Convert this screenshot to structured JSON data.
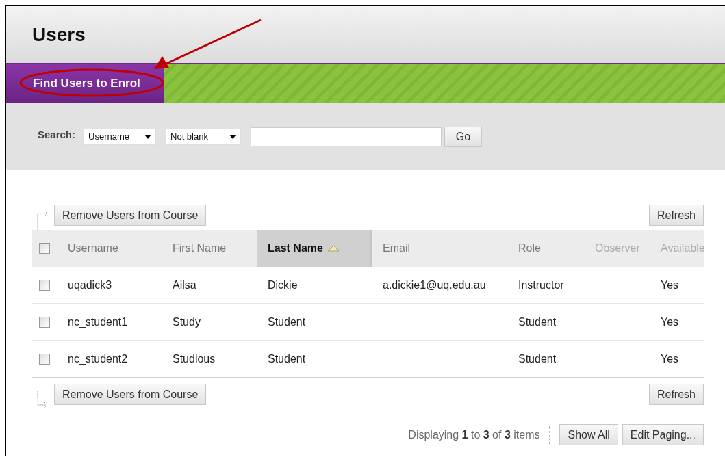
{
  "page": {
    "title": "Users"
  },
  "action_bar": {
    "buttons": [
      {
        "label": "Find Users to Enrol",
        "highlighted": true
      }
    ]
  },
  "search": {
    "label": "Search:",
    "field_select": "Username",
    "operator_select": "Not blank",
    "button": "Go"
  },
  "top_actions": {
    "remove_button": "Remove Users from Course",
    "refresh_button": "Refresh"
  },
  "table": {
    "select_all": {
      "checked": false
    },
    "columns": [
      {
        "label": "Username",
        "sorted": false,
        "disabled": false
      },
      {
        "label": "First Name",
        "sorted": false,
        "disabled": false
      },
      {
        "label": "Last Name",
        "sorted": true,
        "disabled": false
      },
      {
        "label": "Email",
        "sorted": false,
        "disabled": false
      },
      {
        "label": "Role",
        "sorted": false,
        "disabled": false
      },
      {
        "label": "Observer",
        "sorted": false,
        "disabled": true
      },
      {
        "label": "Available",
        "sorted": false,
        "disabled": true
      }
    ],
    "rows": [
      {
        "checked": false,
        "cells": [
          "uqadick3",
          "Ailsa",
          "Dickie",
          "a.dickie1@uq.edu.au",
          "Instructor",
          "",
          "Yes"
        ]
      },
      {
        "checked": false,
        "cells": [
          "nc_student1",
          "Study",
          "Student",
          "",
          "Student",
          "",
          "Yes"
        ]
      },
      {
        "checked": false,
        "cells": [
          "nc_student2",
          "Studious",
          "Student",
          "",
          "Student",
          "",
          "Yes"
        ]
      }
    ]
  },
  "bottom_actions": {
    "remove_button": "Remove Users from Course",
    "refresh_button": "Refresh"
  },
  "paging": {
    "summary": "Displaying **1** to **3** of **3** items",
    "show_all_button": "Show All",
    "edit_paging_button": "Edit Paging..."
  }
}
